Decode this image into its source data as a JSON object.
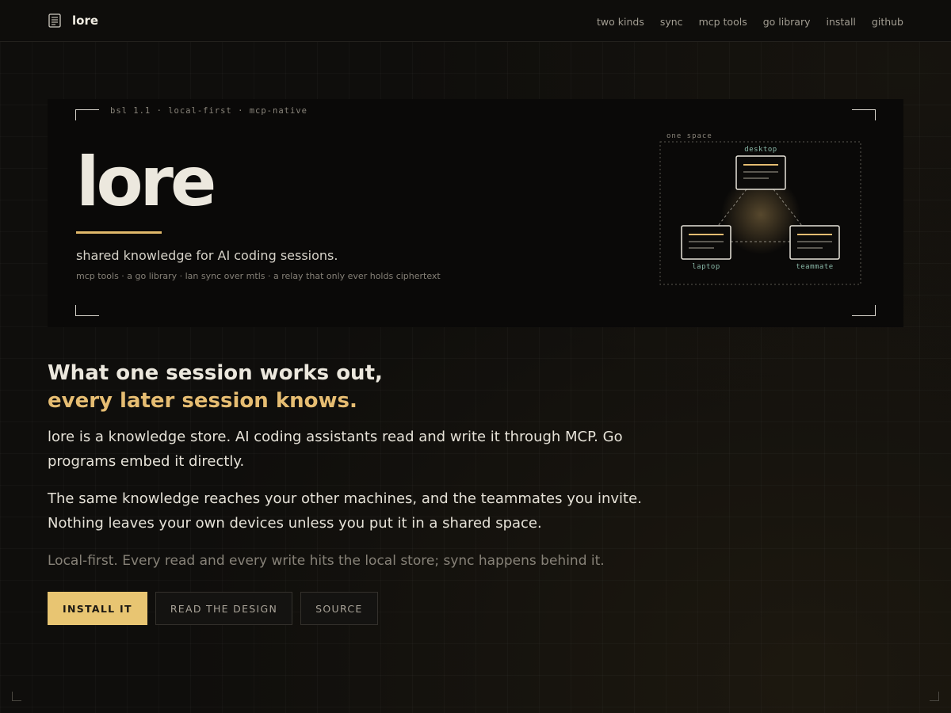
{
  "nav": {
    "brand": "lore",
    "links": [
      "two kinds",
      "sync",
      "mcp tools",
      "go library",
      "install",
      "github"
    ]
  },
  "hero": {
    "meta": "bsl 1.1 · local-first · mcp-native",
    "title": "lore",
    "tagline": "shared knowledge for AI coding sessions.",
    "sub": "mcp tools · a go library · lan sync over mtls · a relay that only ever holds ciphertext",
    "diagram": {
      "space_label": "one space",
      "nodes": [
        "desktop",
        "laptop",
        "teammate"
      ]
    }
  },
  "main": {
    "headline_1": "What one session works out,",
    "headline_2": "every later session knows.",
    "p1": "lore is a knowledge store. AI coding assistants read and write it through MCP. Go programs embed it directly.",
    "p2": "The same knowledge reaches your other machines, and the teammates you invite. Nothing leaves your own devices unless you put it in a shared space.",
    "p3": "Local-first. Every read and every write hits the local store; sync happens behind it."
  },
  "buttons": {
    "install": "INSTALL IT",
    "design": "READ THE DESIGN",
    "source": "SOURCE"
  },
  "colors": {
    "accent": "#e6bd72",
    "background": "#0f0e0c",
    "node_label": "#8ab8a8"
  }
}
